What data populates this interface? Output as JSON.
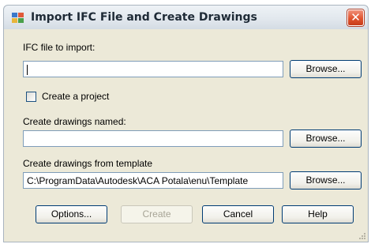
{
  "window": {
    "title": "Import IFC File and Create Drawings",
    "icon": "app-dialog-icon",
    "close_symbol": "✕"
  },
  "ifc_file": {
    "label": "IFC file to import:",
    "value": "",
    "browse_label": "Browse..."
  },
  "project": {
    "label": "Create a project",
    "checked": false
  },
  "drawings_named": {
    "label": "Create drawings named:",
    "value": "",
    "browse_label": "Browse..."
  },
  "template": {
    "label": "Create drawings from template",
    "value": "C:\\ProgramData\\Autodesk\\ACA Potala\\enu\\Template",
    "browse_label": "Browse..."
  },
  "buttons": {
    "options": "Options...",
    "create": "Create",
    "cancel": "Cancel",
    "help": "Help"
  },
  "colors": {
    "dialog_bg": "#ece9d8",
    "close_button": "#e0542f",
    "button_border": "#003c74"
  }
}
